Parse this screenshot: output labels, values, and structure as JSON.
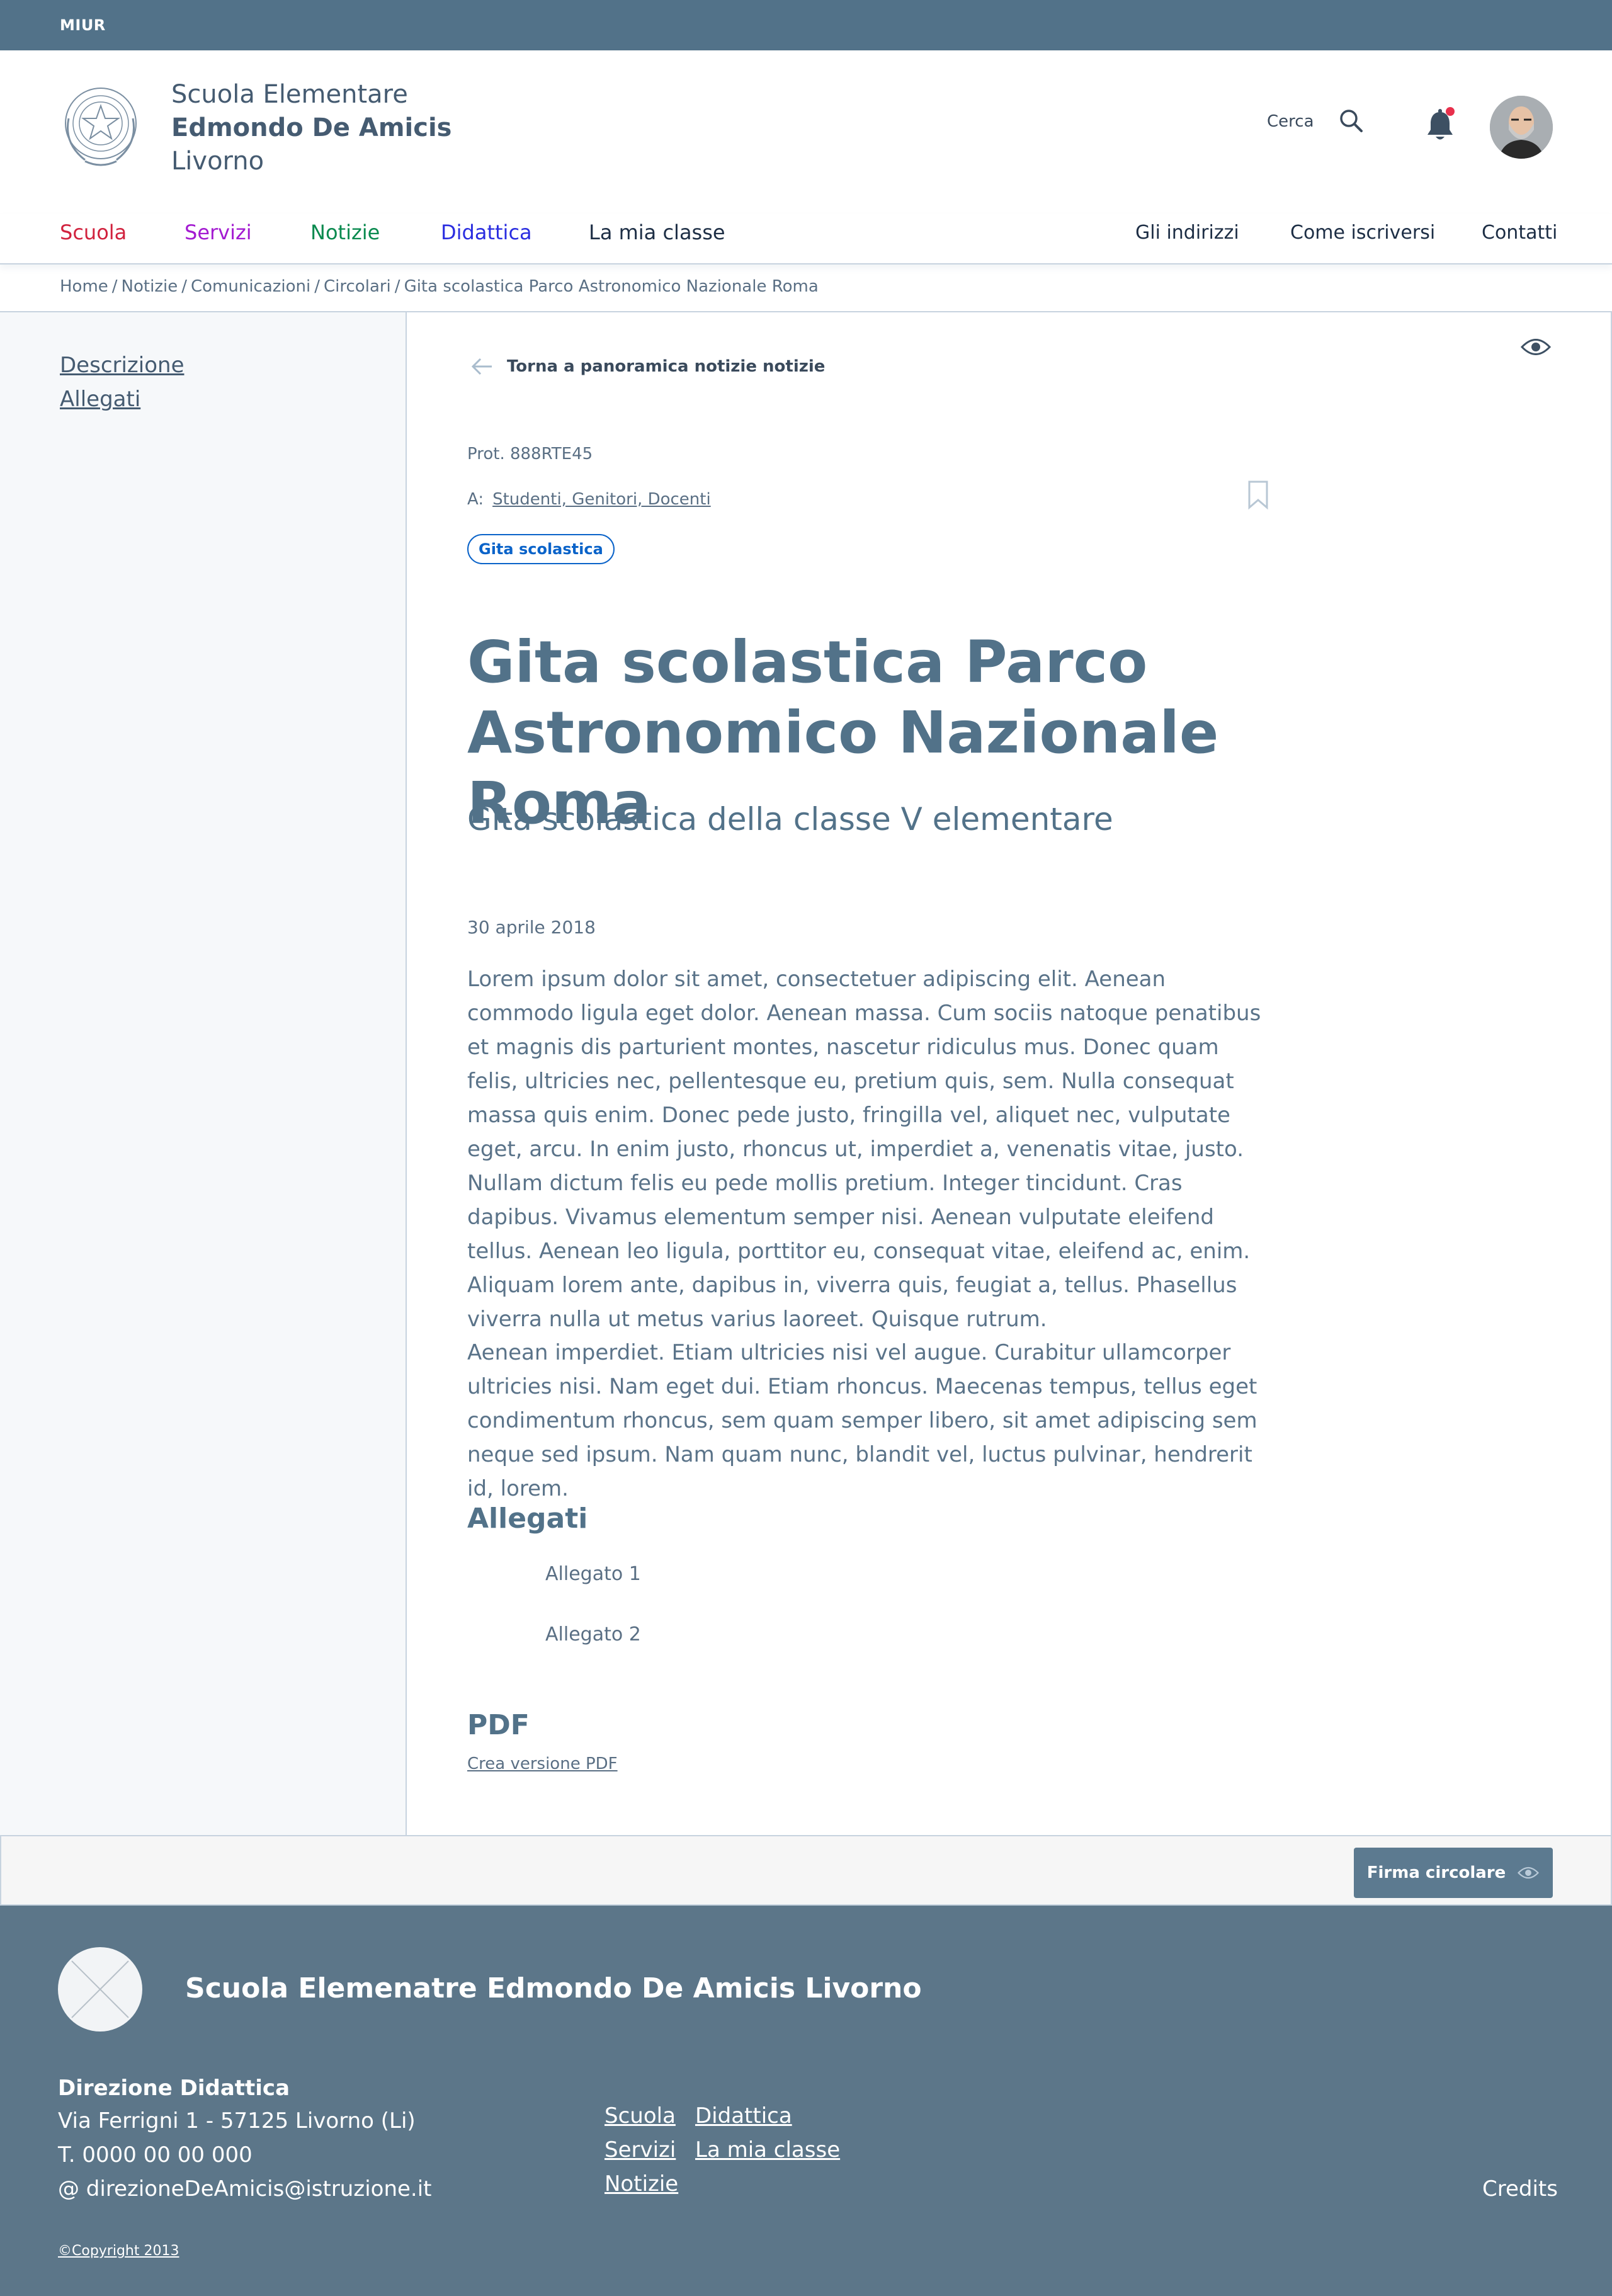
{
  "topbar": {
    "brand": "MIUR"
  },
  "header": {
    "school_line1": "Scuola Elementare",
    "school_line2": "Edmondo De Amicis",
    "school_line3": "Livorno",
    "search_label": "Cerca"
  },
  "nav": {
    "primary": [
      {
        "label": "Scuola",
        "color": "#d1223e"
      },
      {
        "label": "Servizi",
        "color": "#a31bd1"
      },
      {
        "label": "Notizie",
        "color": "#0a8a4f"
      },
      {
        "label": "Didattica",
        "color": "#2a2de0"
      },
      {
        "label": "La mia classe",
        "color": "#1d2e45"
      }
    ],
    "secondary": [
      "Gli indirizzi",
      "Come iscriversi",
      "Contatti"
    ]
  },
  "breadcrumb": [
    "Home",
    "Notizie",
    "Comunicazioni",
    "Circolari",
    "Gita scolastica Parco Astronomico Nazionale Roma"
  ],
  "sidebar": {
    "items": [
      "Descrizione",
      "Allegati"
    ]
  },
  "article": {
    "back_label": "Torna a panoramica notizie notizie",
    "protocol": "Prot. 888RTE45",
    "recipients_prefix": "A:",
    "recipients": "Studenti, Genitori, Docenti",
    "tag": "Gita scolastica",
    "title": "Gita scolastica Parco Astronomico Nazionale Roma",
    "subtitle": "Gita scolastica della classe V elementare",
    "date": "30 aprile 2018",
    "paragraph1": "Lorem ipsum dolor sit amet, consectetuer adipiscing elit. Aenean commodo ligula eget dolor. Aenean massa. Cum sociis natoque penatibus et magnis dis parturient montes, nascetur ridiculus mus. Donec quam felis, ultricies nec, pellentesque eu, pretium quis, sem. Nulla consequat massa quis enim. Donec pede justo, fringilla vel, aliquet nec, vulputate eget, arcu. In enim justo, rhoncus ut, imperdiet a, venenatis vitae, justo. Nullam dictum felis eu pede mollis pretium. Integer tincidunt. Cras dapibus. Vivamus elementum semper nisi. Aenean vulputate eleifend tellus. Aenean leo ligula, porttitor eu, consequat vitae, eleifend ac, enim. Aliquam lorem ante, dapibus in, viverra quis, feugiat a, tellus. Phasellus viverra nulla ut metus varius laoreet. Quisque rutrum.",
    "paragraph2": "Aenean imperdiet. Etiam ultricies nisi vel augue. Curabitur ullamcorper ultricies nisi. Nam eget dui. Etiam rhoncus. Maecenas tempus, tellus eget condimentum rhoncus, sem quam semper libero, sit amet adipiscing sem neque sed ipsum. Nam quam nunc, blandit vel, luctus pulvinar, hendrerit id, lorem.",
    "attachments_heading": "Allegati",
    "attachments": [
      "Allegato 1",
      "Allegato 2"
    ],
    "pdf_heading": "PDF",
    "pdf_link": "Crea versione PDF"
  },
  "sign": {
    "button_label": "Firma circolare"
  },
  "footer": {
    "name": "Scuola Elemenatre Edmondo De Amicis Livorno",
    "direction_title": "Direzione Didattica",
    "address": "Via Ferrigni 1 - 57125 Livorno (Li)",
    "phone": "T. 0000 00 00 000",
    "email": "@ direzioneDeAmicis@istruzione.it",
    "links_col1": [
      "Scuola",
      "Servizi",
      "Notizie"
    ],
    "links_col2": [
      "Didattica",
      "La mia classe"
    ],
    "credits": "Credits",
    "copyright": "©Copyright 2013"
  }
}
